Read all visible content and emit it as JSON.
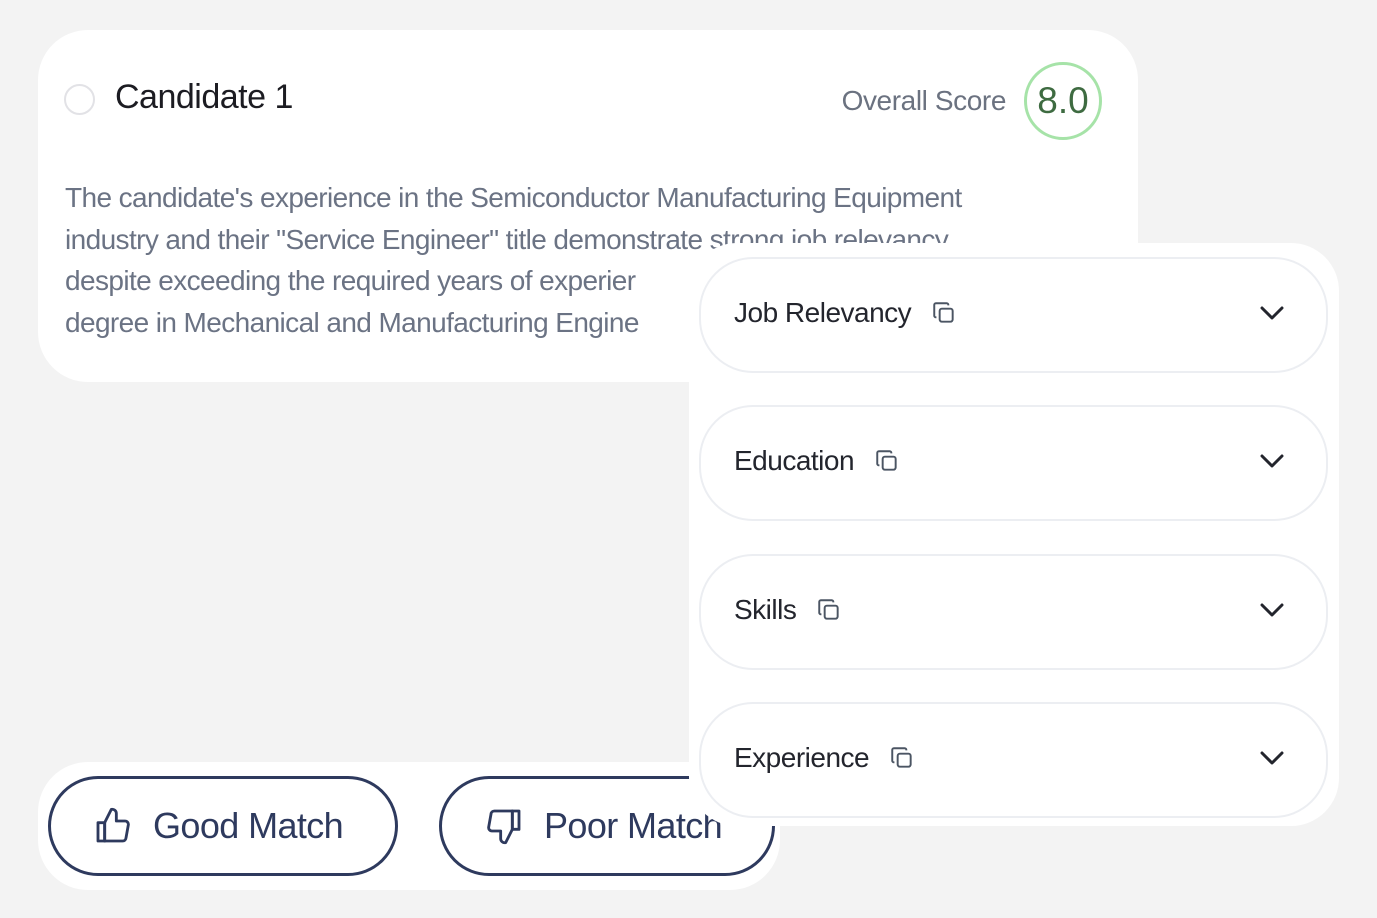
{
  "candidate": {
    "name": "Candidate 1",
    "score_label": "Overall Score",
    "score": "8.0",
    "summary_lines": [
      "The candidate's experience in the Semiconductor Manufacturing Equipment",
      "industry and their \"Service Engineer\" title demonstrate strong job relevancy",
      "despite exceeding the required years of experier",
      "degree in Mechanical and Manufacturing Engine"
    ]
  },
  "feedback": {
    "good_label": "Good Match",
    "good_icon": "thumbs-up-icon",
    "poor_label": "Poor Match",
    "poor_icon": "thumbs-down-icon"
  },
  "criteria": [
    {
      "label": "Job Relevancy",
      "icon": "copy-icon",
      "expand_icon": "chevron-down-icon"
    },
    {
      "label": "Education",
      "icon": "copy-icon",
      "expand_icon": "chevron-down-icon"
    },
    {
      "label": "Skills",
      "icon": "copy-icon",
      "expand_icon": "chevron-down-icon"
    },
    {
      "label": "Experience",
      "icon": "copy-icon",
      "expand_icon": "chevron-down-icon"
    }
  ],
  "colors": {
    "background": "#f3f3f3",
    "card": "#ffffff",
    "accent_navy": "#2e3a5e",
    "score_ring": "#a6e3a8",
    "score_text": "#3e6b41",
    "muted_text": "#6b7384"
  }
}
